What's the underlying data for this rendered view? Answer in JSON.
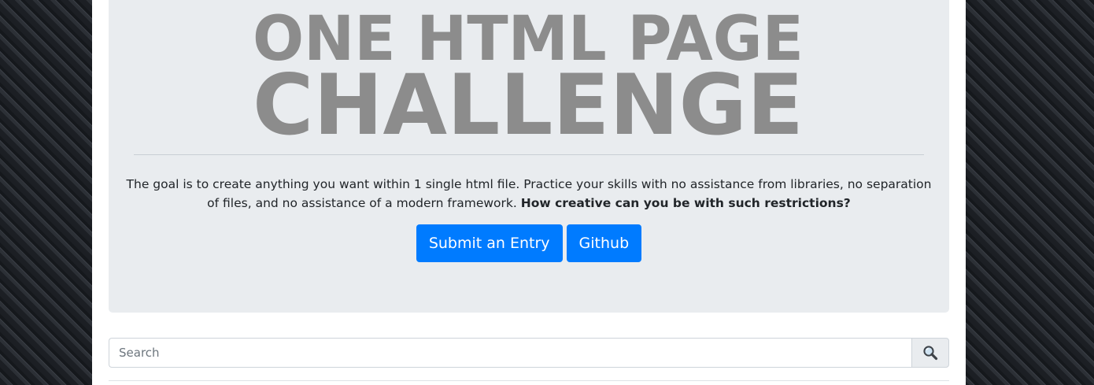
{
  "hero": {
    "logo_line1": "ONE HTML PAGE",
    "logo_line2": "CHALLENGE",
    "description": "The goal is to create anything you want within 1 single html file. Practice your skills with no assistance from libraries, no separation of files, and no assistance of a modern framework.",
    "description_bold": "How creative can you be with such restrictions?",
    "submit_label": "Submit an Entry",
    "github_label": "Github"
  },
  "search": {
    "placeholder": "Search",
    "value": "",
    "button_icon": "magnifier-icon"
  },
  "colors": {
    "primary": "#007bff",
    "jumbotron_bg": "#e9ecef",
    "logo_gray": "#8c8c8c"
  }
}
